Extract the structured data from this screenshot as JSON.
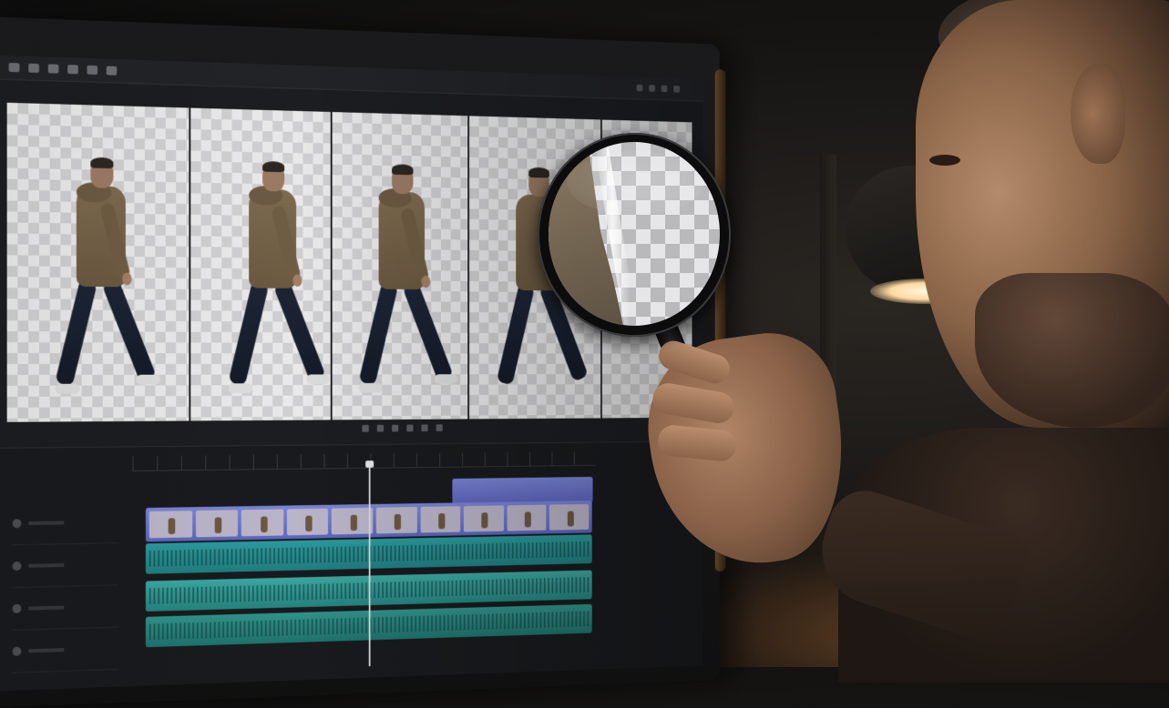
{
  "scene": {
    "description_free": true
  },
  "colors": {
    "video_track": "#6f78cf",
    "audio_track": "#24888a",
    "lamp_glow": "#ffe2b3",
    "checker_light": "#e9e9ea",
    "checker_dark": "#cfcfd1"
  },
  "icons": [
    "magnifying-glass-icon",
    "desk-lamp-icon"
  ]
}
